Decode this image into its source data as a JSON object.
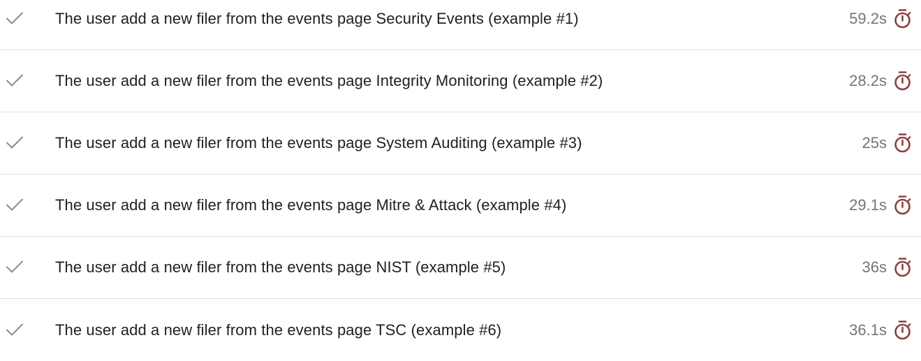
{
  "colors": {
    "passed": "#7a9a78",
    "timer": "#8d4141",
    "title_text": "#212121",
    "duration_text": "#757575",
    "divider": "#e0e0e0"
  },
  "icons": {
    "status": "check-icon",
    "duration": "stopwatch-icon"
  },
  "tests": [
    {
      "title": "The user add a new filer from the events page Security Events (example #1)",
      "duration": "59.2s",
      "status": "passed"
    },
    {
      "title": "The user add a new filer from the events page Integrity Monitoring (example #2)",
      "duration": "28.2s",
      "status": "passed"
    },
    {
      "title": "The user add a new filer from the events page System Auditing (example #3)",
      "duration": "25s",
      "status": "passed"
    },
    {
      "title": "The user add a new filer from the events page Mitre & Attack (example #4)",
      "duration": "29.1s",
      "status": "passed"
    },
    {
      "title": "The user add a new filer from the events page NIST (example #5)",
      "duration": "36s",
      "status": "passed"
    },
    {
      "title": "The user add a new filer from the events page TSC (example #6)",
      "duration": "36.1s",
      "status": "passed"
    }
  ]
}
